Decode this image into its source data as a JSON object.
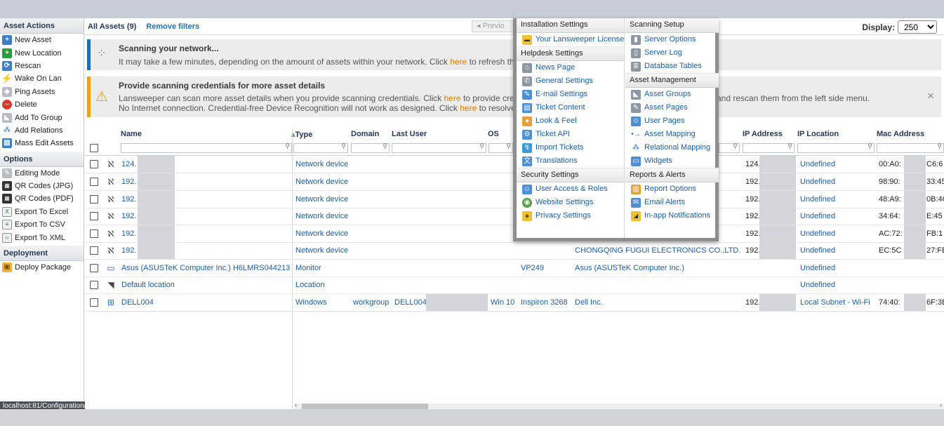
{
  "sidebar": {
    "asset_actions_title": "Asset Actions",
    "asset_actions": [
      {
        "label": "New Asset",
        "icon": "plus-icon"
      },
      {
        "label": "New Location",
        "icon": "plus-icon"
      },
      {
        "label": "Rescan",
        "icon": "rescan-icon"
      },
      {
        "label": "Wake On Lan",
        "icon": "lightning-icon"
      },
      {
        "label": "Ping Assets",
        "icon": "ping-icon"
      },
      {
        "label": "Delete",
        "icon": "delete-icon"
      },
      {
        "label": "Add To Group",
        "icon": "tag-icon"
      },
      {
        "label": "Add Relations",
        "icon": "relations-icon"
      },
      {
        "label": "Mass Edit Assets",
        "icon": "mass-edit-icon"
      }
    ],
    "options_title": "Options",
    "options": [
      {
        "label": "Editing Mode",
        "icon": "pencil-icon"
      },
      {
        "label": "QR Codes (JPG)",
        "icon": "qr-icon"
      },
      {
        "label": "QR Codes (PDF)",
        "icon": "qr-icon"
      },
      {
        "label": "Export To Excel",
        "icon": "excel-icon"
      },
      {
        "label": "Export To CSV",
        "icon": "csv-icon"
      },
      {
        "label": "Export To XML",
        "icon": "xml-icon"
      }
    ],
    "deployment_title": "Deployment",
    "deployment": [
      {
        "label": "Deploy Package",
        "icon": "package-icon"
      }
    ],
    "status_url": "localhost:81/Configuration/"
  },
  "toolbar": {
    "all_assets": "All Assets (9)",
    "remove_filters": "Remove filters",
    "previous": "Previo",
    "display_label": "Display:",
    "display_value": "250"
  },
  "notices": {
    "scanning_title": "Scanning your network...",
    "scanning_text_pre": "It may take a few minutes, depending on the amount of assets within your network. Click ",
    "scanning_link": "here",
    "scanning_text_post": " to refresh the a",
    "creds_title": "Provide scanning credentials for more asset details",
    "creds_text1_pre": "Lansweeper can scan more asset details when you provide scanning credentials. Click ",
    "creds_link1": "here",
    "creds_text1_post": " to provide crede",
    "creds_text1_tail": "and rescan them from the left side menu.",
    "creds_text2_pre": "No Internet connection. Credential-free Device Recognition will not work as designed. Click ",
    "creds_link2": "here",
    "creds_text2_post": " to resolve th",
    "close": "×"
  },
  "grid": {
    "columns": {
      "name": "Name",
      "type": "Type",
      "domain": "Domain",
      "last_user": "Last User",
      "os": "OS",
      "ip": "IP Address",
      "ip_location": "IP Location",
      "mac": "Mac Address"
    },
    "rows": [
      {
        "name": "124.",
        "type": "Network device",
        "ip": "124.",
        "location": "Undefined",
        "mac": "00:A0:",
        "mac_tail": "C6:6",
        "icon": "network-icon"
      },
      {
        "name": "192.",
        "type": "Network device",
        "ip": "192.",
        "location": "Undefined",
        "mac": "98:90:",
        "mac_tail": "33:45",
        "icon": "network-icon"
      },
      {
        "name": "192.",
        "type": "Network device",
        "ip": "192.",
        "location": "Undefined",
        "mac": "48:A9:",
        "mac_tail": "0B:4C",
        "icon": "network-icon"
      },
      {
        "name": "192.",
        "type": "Network device",
        "ip": "192.",
        "location": "Undefined",
        "mac": "34:64:",
        "mac_tail": "E:45",
        "icon": "network-icon"
      },
      {
        "name": "192.",
        "type": "Network device",
        "ip": "192.",
        "location": "Undefined",
        "mac": "AC:72:",
        "mac_tail": "FB:1",
        "icon": "network-icon"
      },
      {
        "name": "192.",
        "type": "Network device",
        "manufacturer": "CHONGQING FUGUI ELECTRONICS CO.,LTD.",
        "ip": "192.",
        "location": "Undefined",
        "mac": "EC:5C",
        "mac_tail": "27:FE",
        "icon": "network-icon"
      },
      {
        "name": "Asus (ASUSTeK Computer Inc.) H6LMRS044213",
        "type": "Monitor",
        "model": "VP249",
        "manufacturer": "Asus (ASUSTeK Computer Inc.)",
        "location": "Undefined",
        "icon": "monitor-icon"
      },
      {
        "name": "Default location",
        "type": "Location",
        "location": "Undefined",
        "icon": "location-icon"
      },
      {
        "name": "DELL004",
        "type": "Windows",
        "domain": "workgroup",
        "last_user": "DELL004",
        "os": "Win 10",
        "model": "Inspiron 3268",
        "manufacturer": "Dell Inc.",
        "ip": "192.",
        "location": "Local Subnet - Wi-Fi",
        "mac": "74:40:",
        "mac_tail": "6F:3E",
        "icon": "windows-icon"
      }
    ]
  },
  "menu": {
    "installation_title": "Installation Settings",
    "installation": [
      {
        "label": "Your Lansweeper License",
        "icon": "license-icon"
      }
    ],
    "helpdesk_title": "Helpdesk Settings",
    "helpdesk": [
      {
        "label": "News Page",
        "icon": "news-icon"
      },
      {
        "label": "General Settings",
        "icon": "wrench-icon"
      },
      {
        "label": "E-mail Settings",
        "icon": "email-icon"
      },
      {
        "label": "Ticket Content",
        "icon": "ticket-icon"
      },
      {
        "label": "Look & Feel",
        "icon": "palette-icon"
      },
      {
        "label": "Ticket API",
        "icon": "api-icon"
      },
      {
        "label": "Import Tickets",
        "icon": "import-icon"
      },
      {
        "label": "Translations",
        "icon": "translate-icon"
      }
    ],
    "security_title": "Security Settings",
    "security": [
      {
        "label": "User Access & Roles",
        "icon": "users-icon"
      },
      {
        "label": "Website Settings",
        "icon": "globe-icon"
      },
      {
        "label": "Privacy Settings",
        "icon": "shield-icon"
      }
    ],
    "scanning_title": "Scanning Setup",
    "scanning": [
      {
        "label": "Server Options",
        "icon": "server-icon"
      },
      {
        "label": "Server Log",
        "icon": "log-icon"
      },
      {
        "label": "Database Tables",
        "icon": "database-icon"
      }
    ],
    "asset_mgmt_title": "Asset Management",
    "asset_mgmt": [
      {
        "label": "Asset Groups",
        "icon": "tag-icon"
      },
      {
        "label": "Asset Pages",
        "icon": "pages-icon"
      },
      {
        "label": "User Pages",
        "icon": "user-icon"
      },
      {
        "label": "Asset Mapping",
        "icon": "mapping-icon"
      },
      {
        "label": "Relational Mapping",
        "icon": "relations-icon"
      },
      {
        "label": "Widgets",
        "icon": "widgets-icon"
      }
    ],
    "reports_title": "Reports & Alerts",
    "reports": [
      {
        "label": "Report Options",
        "icon": "report-icon"
      },
      {
        "label": "Email Alerts",
        "icon": "mail-icon"
      },
      {
        "label": "In-app Notifications",
        "icon": "bell-icon"
      }
    ]
  }
}
